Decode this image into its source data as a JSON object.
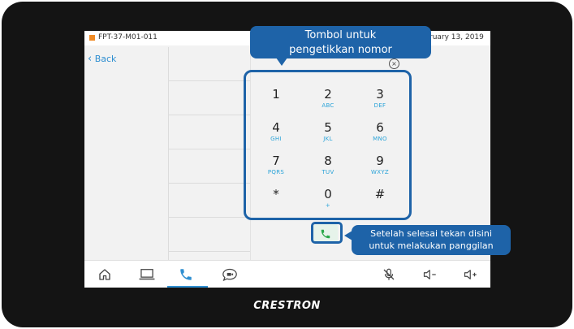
{
  "status_bar": {
    "device_id": "FPT-37-M01-011",
    "date": "ruary 13, 2019",
    "indicator_color": "#f08a24"
  },
  "navigation": {
    "back_label": "Back",
    "back_icon": "chevron-left-icon"
  },
  "dialpad": {
    "delete_icon": "backspace-circle-icon",
    "keys": [
      {
        "digit": "1",
        "letters": ""
      },
      {
        "digit": "2",
        "letters": "ABC"
      },
      {
        "digit": "3",
        "letters": "DEF"
      },
      {
        "digit": "4",
        "letters": "GHI"
      },
      {
        "digit": "5",
        "letters": "JKL"
      },
      {
        "digit": "6",
        "letters": "MNO"
      },
      {
        "digit": "7",
        "letters": "PQRS"
      },
      {
        "digit": "8",
        "letters": "TUV"
      },
      {
        "digit": "9",
        "letters": "WXYZ"
      },
      {
        "digit": "*",
        "letters": ""
      },
      {
        "digit": "0",
        "letters": "+"
      },
      {
        "digit": "#",
        "letters": ""
      }
    ],
    "call_icon": "phone-icon",
    "call_color": "#2aa84a"
  },
  "bottom_nav": {
    "items": [
      "home-icon",
      "laptop-icon",
      "phone-icon",
      "video-chat-icon"
    ],
    "active": "phone-icon",
    "audio": [
      "mic-muted-icon",
      "volume-down-icon",
      "volume-up-icon"
    ]
  },
  "annotations": {
    "keypad_callout_line1": "Tombol untuk",
    "keypad_callout_line2": "pengetikkan nomor",
    "call_callout_line1": "Setelah selesai tekan disini",
    "call_callout_line2": "untuk melakukan panggilan",
    "highlight_color": "#1e63a8"
  },
  "brand": {
    "logo_text": "CRESTRON"
  },
  "colors": {
    "accent": "#2f8fd1",
    "letters": "#2aa3d8",
    "bezel": "#141414"
  }
}
